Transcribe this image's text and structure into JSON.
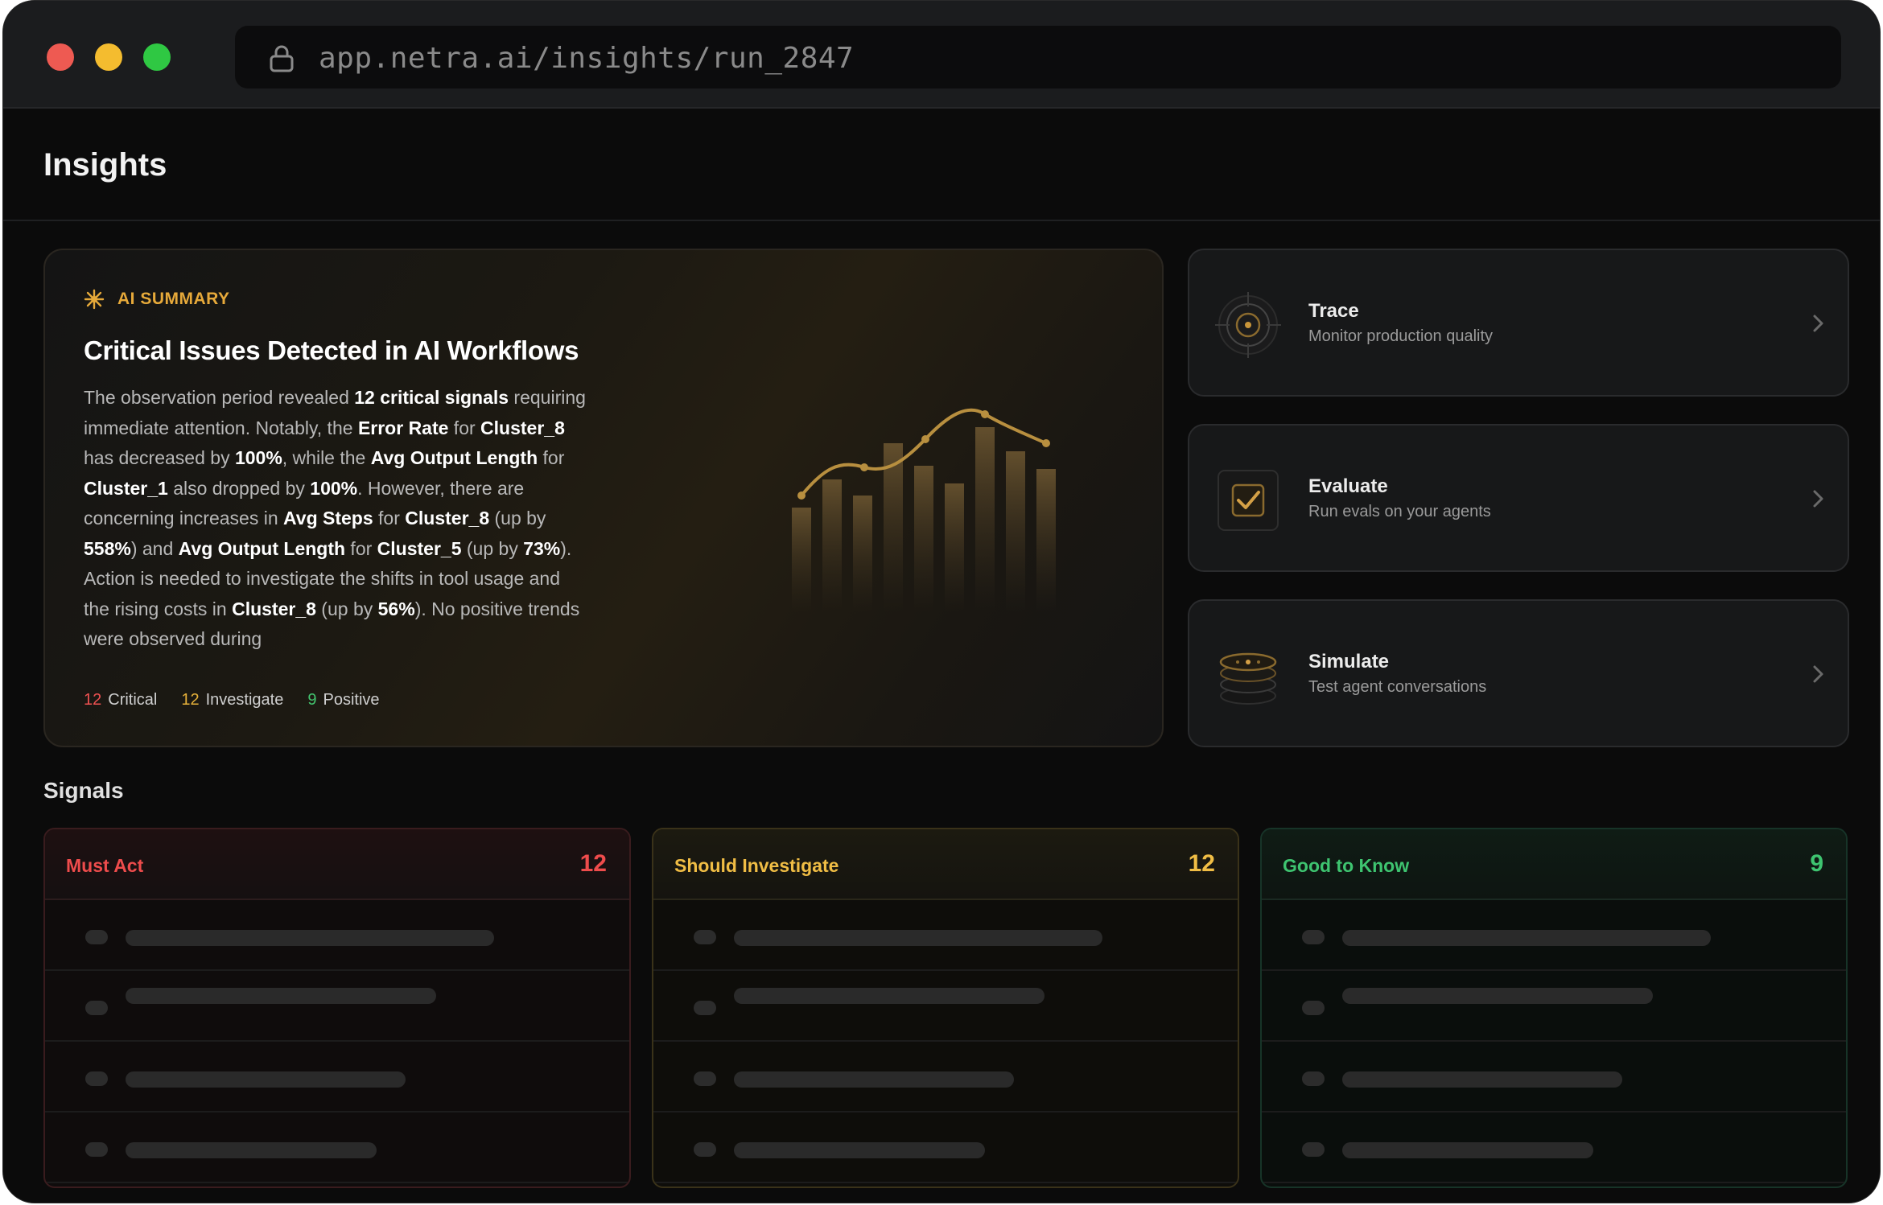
{
  "browser": {
    "url": "app.netra.ai/insights/run_2847"
  },
  "page": {
    "title": "Insights"
  },
  "summary": {
    "label": "AI SUMMARY",
    "title": "Critical Issues Detected in AI Workflows",
    "body_html": "The observation period revealed <b>12 critical signals</b> requiring immediate attention. Notably, the <b>Error Rate</b> for <b>Cluster_8</b> has decreased by <b>100%</b>, while the <b>Avg Output Length</b> for <b>Cluster_1</b> also dropped by <b>100%</b>. However, there are concerning increases in <b>Avg Steps</b> for <b>Cluster_8</b> (up by <b>558%</b>) and <b>Avg Output Length</b> for <b>Cluster_5</b> (up by <b>73%</b>). Action is needed to investigate the shifts in tool usage and the rising costs in <b>Cluster_8</b> (up by <b>56%</b>). No positive trends were observed during",
    "counts": [
      {
        "num": "12",
        "label": "Critical",
        "color": "#ee5151"
      },
      {
        "num": "12",
        "label": "Investigate",
        "color": "#e6b13a"
      },
      {
        "num": "9",
        "label": "Positive",
        "color": "#43c36e"
      }
    ]
  },
  "features": [
    {
      "title": "Trace",
      "subtitle": "Monitor production quality",
      "icon": "target-icon"
    },
    {
      "title": "Evaluate",
      "subtitle": "Run evals on your agents",
      "icon": "checkbox-icon"
    },
    {
      "title": "Simulate",
      "subtitle": "Test agent conversations",
      "icon": "stack-icon"
    }
  ],
  "signals": {
    "title": "Signals",
    "columns": [
      {
        "title": "Must Act",
        "count": "12",
        "color": "#ee4c4c"
      },
      {
        "title": "Should Investigate",
        "count": "12",
        "color": "#f0bd45"
      },
      {
        "title": "Good to Know",
        "count": "9",
        "color": "#3ec470"
      }
    ]
  },
  "colors": {
    "accent_gold": "#e6a93a",
    "critical": "#ee5151",
    "investigate": "#e6b13a",
    "positive": "#43c36e"
  }
}
